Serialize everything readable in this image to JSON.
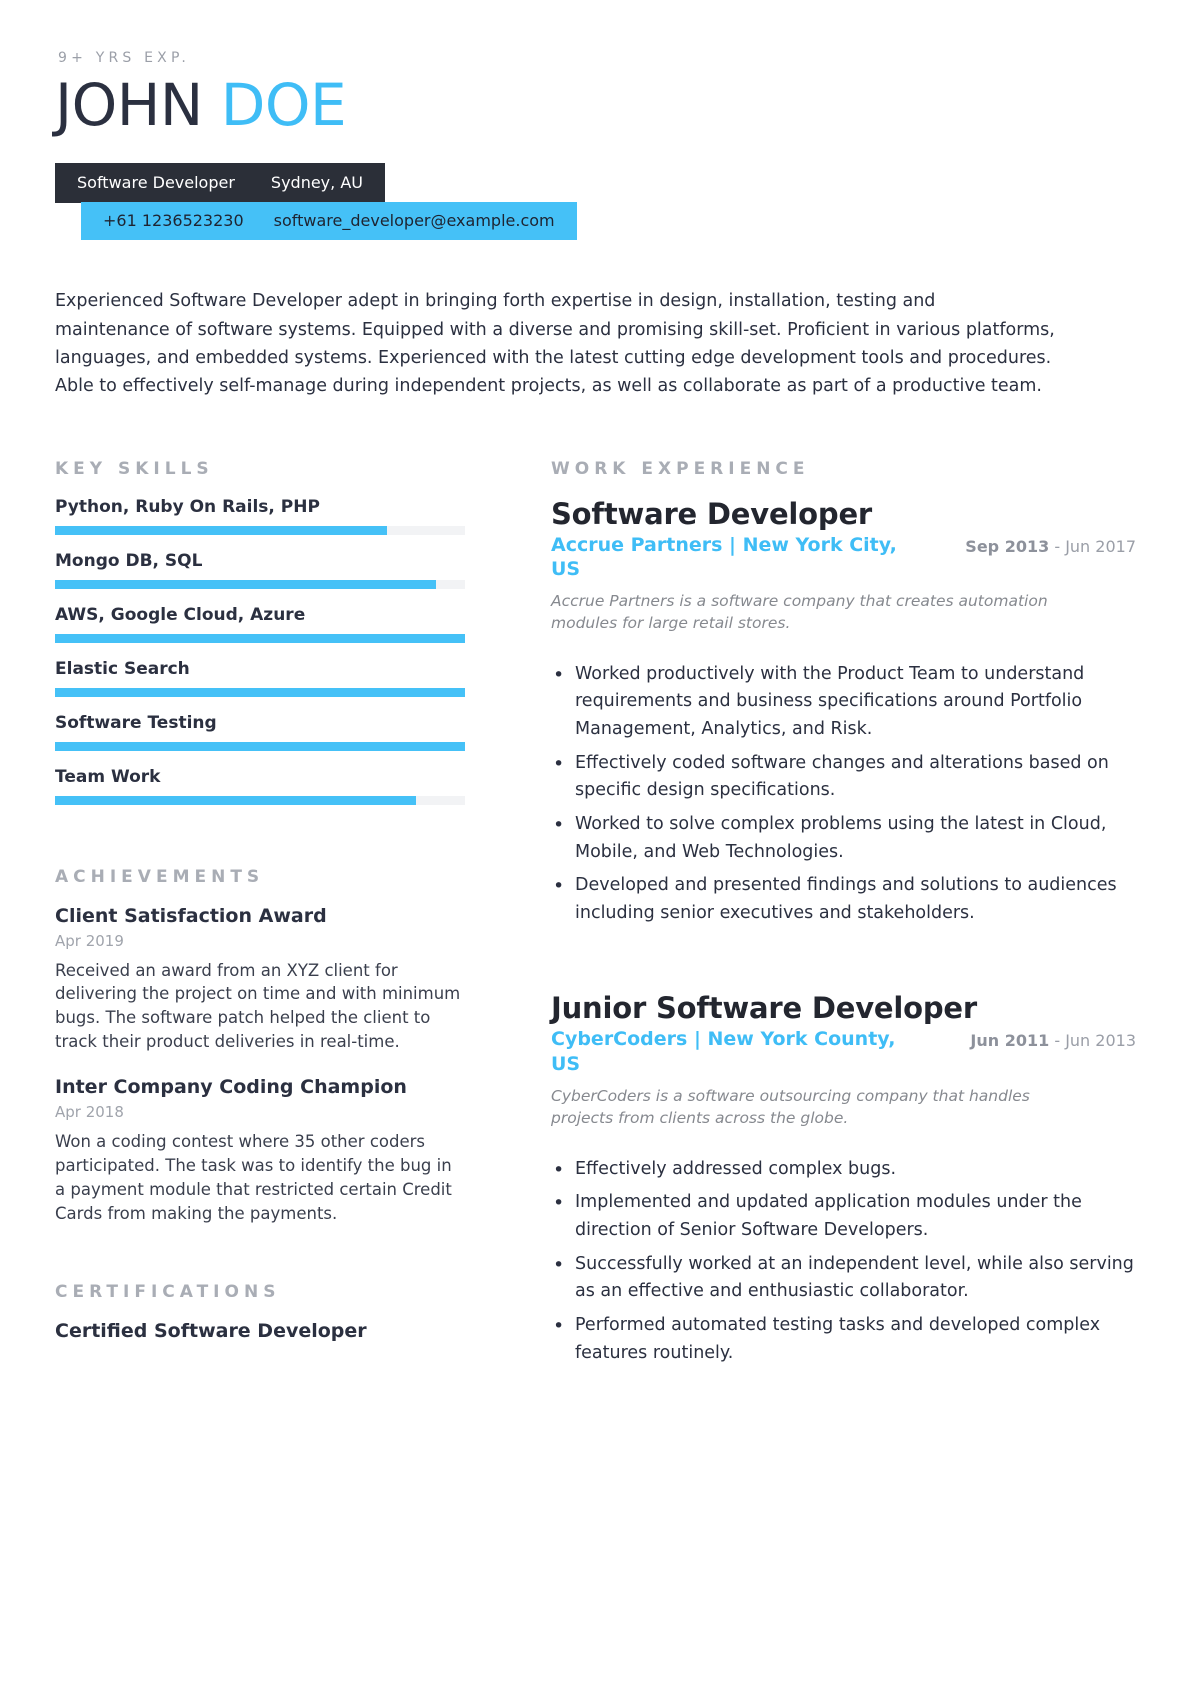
{
  "header": {
    "kicker": "9+ YRS EXP.",
    "first_name": "JOHN",
    "last_name": "DOE",
    "role": "Software Developer",
    "location": "Sydney, AU",
    "phone": "+61 1236523230",
    "email": "software_developer@example.com",
    "accent_color": "#45c1f7",
    "dark_color": "#2b2f38"
  },
  "summary": {
    "text": "Experienced Software Developer adept in bringing forth expertise in design, installation, testing and maintenance of software systems. Equipped with a diverse and promising skill-set. Proficient in various platforms, languages, and embedded systems. Experienced with the latest cutting edge development tools and procedures. Able to effectively self-manage during independent projects, as well as collaborate as part of a productive team."
  },
  "key_skills": {
    "title": "KEY SKILLS",
    "items": [
      {
        "label": "Python, Ruby On Rails, PHP",
        "level": 81
      },
      {
        "label": "Mongo DB, SQL",
        "level": 93
      },
      {
        "label": "AWS, Google Cloud, Azure",
        "level": 100
      },
      {
        "label": "Elastic Search",
        "level": 100
      },
      {
        "label": "Software Testing",
        "level": 100
      },
      {
        "label": "Team Work",
        "level": 88
      }
    ]
  },
  "achievements": {
    "title": "ACHIEVEMENTS",
    "items": [
      {
        "title": "Client Satisfaction Award",
        "date": "Apr 2019",
        "description": "Received an award from an XYZ client for delivering the project on time and with minimum bugs. The software patch helped the client to track their product deliveries in real-time."
      },
      {
        "title": "Inter Company Coding Champion",
        "date": "Apr 2018",
        "description": "Won a coding contest where 35 other coders participated. The task was to identify the bug in a payment module that restricted certain Credit Cards from making the payments."
      }
    ]
  },
  "certifications": {
    "title": "CERTIFICATIONS",
    "items": [
      {
        "title": "Certified Software Developer"
      }
    ]
  },
  "work_experience": {
    "title": "WORK EXPERIENCE",
    "jobs": [
      {
        "title": "Software Developer",
        "company": "Accrue Partners | New York City, US",
        "date_start": "Sep 2013",
        "date_end": "- Jun 2017",
        "description": "Accrue Partners is a software company that creates automation modules for large retail stores.",
        "bullets": [
          "Worked productively with the Product Team to understand requirements and business specifications around Portfolio Management, Analytics, and Risk.",
          "Effectively coded software changes and alterations based on specific design specifications.",
          "Worked to solve complex problems using the latest in Cloud, Mobile, and Web Technologies.",
          "Developed and presented findings and solutions to audiences including senior executives and stakeholders."
        ]
      },
      {
        "title": "Junior Software Developer",
        "company": "CyberCoders | New York County, US",
        "date_start": "Jun 2011",
        "date_end": "- Jun 2013",
        "description": "CyberCoders is a software outsourcing company that handles projects from clients across the globe.",
        "bullets": [
          "Effectively addressed complex bugs.",
          "Implemented and updated application modules under the direction of Senior Software Developers.",
          "Successfully worked at an independent level, while also serving as an effective and enthusiastic collaborator.",
          "Performed automated testing tasks and developed complex features routinely."
        ]
      }
    ]
  }
}
